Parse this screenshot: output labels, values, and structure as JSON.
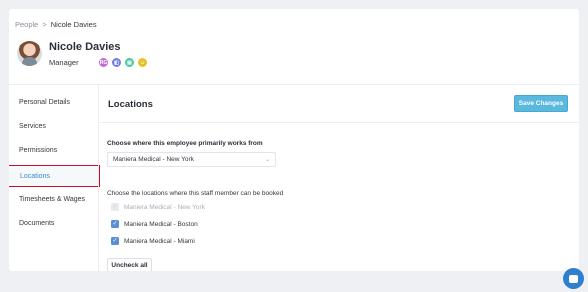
{
  "breadcrumb": {
    "root": "People",
    "separator": ">",
    "current": "Nicole Davies"
  },
  "profile": {
    "name": "Nicole Davies",
    "role": "Manager"
  },
  "badges": [
    {
      "label": "RG",
      "color": "#c46ad6"
    },
    {
      "label": "◧",
      "color": "#6f7ee0"
    },
    {
      "label": "▤",
      "color": "#4fc6a6"
    },
    {
      "label": "☺",
      "color": "#e8c02a"
    }
  ],
  "sidebar": {
    "items": [
      {
        "label": "Personal Details"
      },
      {
        "label": "Services"
      },
      {
        "label": "Permissions"
      },
      {
        "label": "Locations"
      },
      {
        "label": "Timesheets & Wages"
      },
      {
        "label": "Documents"
      }
    ],
    "active_index": 3
  },
  "main": {
    "title": "Locations",
    "save_label": "Save Changes",
    "primary_label": "Choose where this employee primarily works from",
    "primary_value": "Maniera Medical - New York",
    "booked_label": "Choose the locations where this staff member can be booked",
    "locations": [
      {
        "label": "Maniera Medical - New York",
        "checked": true,
        "disabled": true
      },
      {
        "label": "Maniera Medical - Boston",
        "checked": true,
        "disabled": false
      },
      {
        "label": "Maniera Medical - Miami",
        "checked": true,
        "disabled": false
      }
    ],
    "uncheck_all_label": "Uncheck all"
  },
  "colors": {
    "accent": "#5bb8df",
    "active_outline": "#c8102e",
    "checkbox": "#5b8fd6",
    "chat": "#2f7fcf"
  }
}
